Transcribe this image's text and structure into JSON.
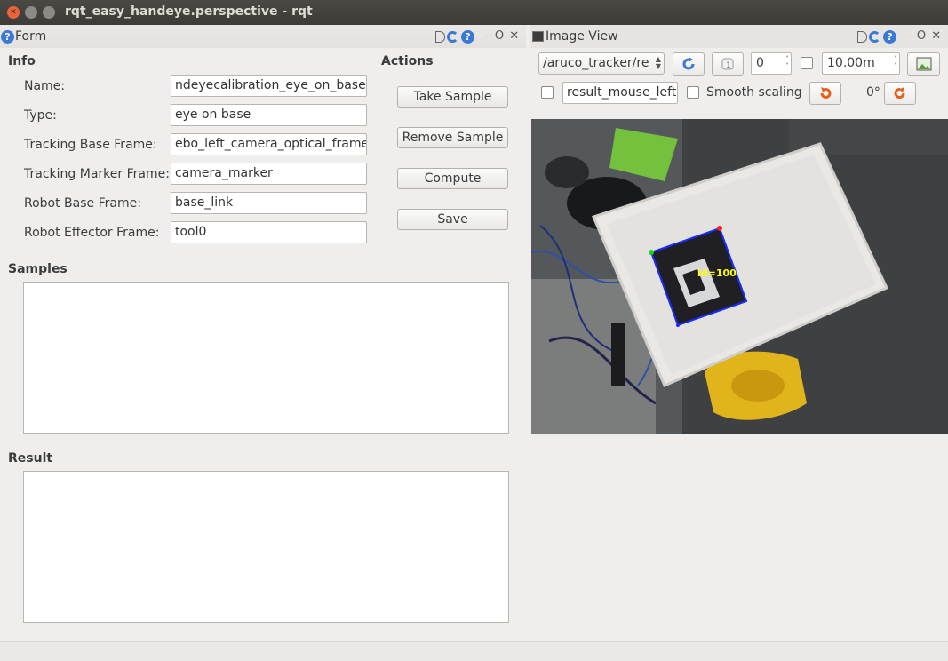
{
  "window": {
    "title": "rqt_easy_handeye.perspective - rqt"
  },
  "form_dock": {
    "title": "Form",
    "controls": "DC? - O ✕"
  },
  "image_dock": {
    "title": "Image View",
    "controls": "DC? - O ✕"
  },
  "info": {
    "heading": "Info",
    "fields": [
      {
        "label": "Name:",
        "value": "ndeyecalibration_eye_on_base/"
      },
      {
        "label": "Type:",
        "value": "eye on base"
      },
      {
        "label": "Tracking Base Frame:",
        "value": "ebo_left_camera_optical_frame"
      },
      {
        "label": "Tracking Marker Frame:",
        "value": "camera_marker"
      },
      {
        "label": "Robot Base Frame:",
        "value": "base_link"
      },
      {
        "label": "Robot Effector Frame:",
        "value": "tool0"
      }
    ]
  },
  "actions": {
    "heading": "Actions",
    "buttons": [
      "Take Sample",
      "Remove Sample",
      "Compute",
      "Save"
    ]
  },
  "samples": {
    "heading": "Samples"
  },
  "result": {
    "heading": "Result"
  },
  "image_view": {
    "topic": "/aruco_tracker/re",
    "zoom_value": "0",
    "max_value": "10.00m",
    "mouse_topic": "result_mouse_left",
    "smooth_scaling_label": "Smooth scaling",
    "rotation": "0°",
    "marker_label": "id=100"
  },
  "colors": {
    "titlebar": "#3c3b37",
    "close_button": "#e9643a",
    "accent_blue": "#3b79d6",
    "marker_outline": "#1a2cff",
    "marker_text": "#ffff00"
  }
}
